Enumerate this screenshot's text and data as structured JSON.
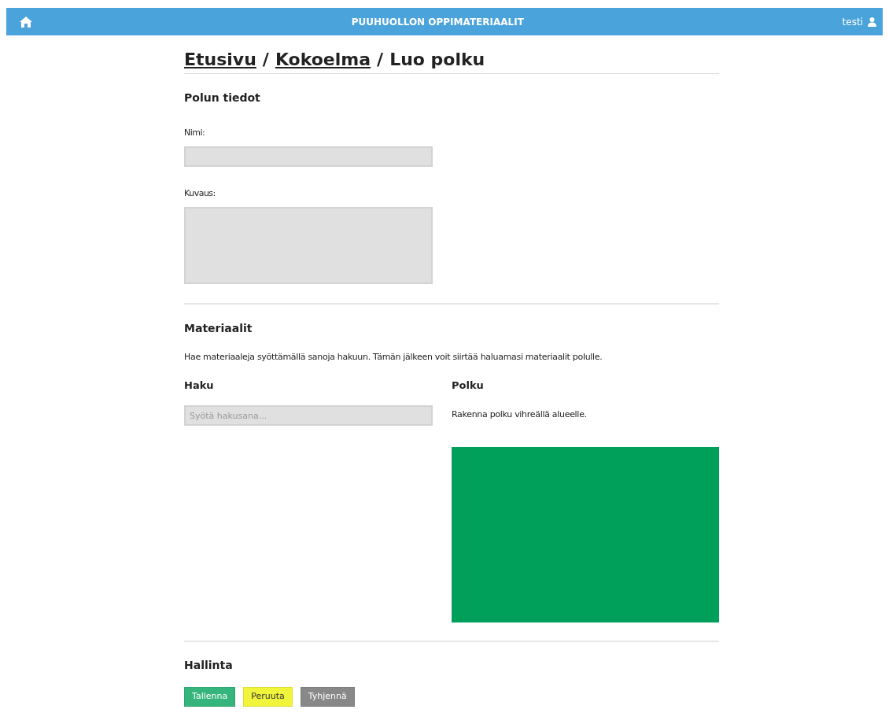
{
  "navbar": {
    "title": "PUUHUOLLON OPPIMATERIAALIT",
    "user": "testi"
  },
  "breadcrumb": [
    {
      "label": "Etusivu",
      "kind": "link"
    },
    {
      "separator": "/",
      "label": "Kokoelma",
      "kind": "link"
    },
    {
      "separator": "/",
      "label": "Luo polku",
      "kind": "current"
    }
  ],
  "path_info": {
    "heading": "Polun tiedot",
    "name_label": "Nimi:",
    "description_label": "Kuvaus:"
  },
  "materials": {
    "heading": "Materiaalit",
    "instructions": "Hae materiaaleja syöttämällä sanoja hakuun. Tämän jälkeen voit siirtää haluamasi materiaalit polulle.",
    "search_heading": "Haku",
    "search": {
      "placeholder": "Syötä hakusana..."
    },
    "path_heading": "Polku",
    "path_hint": "Rakenna polku vihreällä alueelle."
  },
  "controls": {
    "heading": "Hallinta",
    "buttons": [
      {
        "label": "Tallenna",
        "kind": "save"
      },
      {
        "label": "Peruuta",
        "kind": "cancel"
      },
      {
        "label": "Tyhjennä",
        "kind": "clear"
      }
    ]
  }
}
